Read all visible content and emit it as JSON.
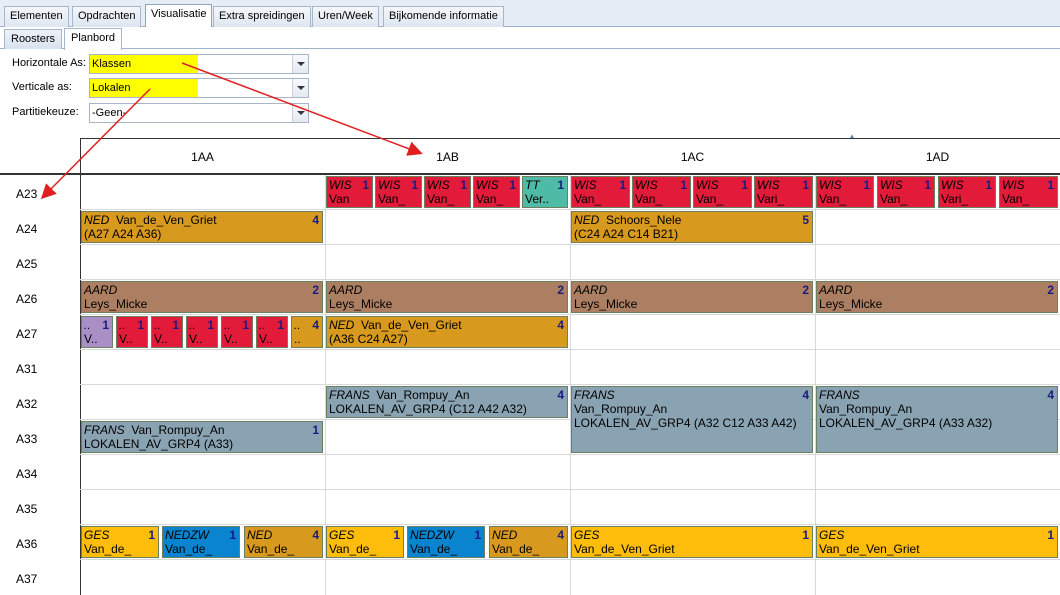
{
  "tabs": [
    "Elementen",
    "Opdrachten",
    "Visualisatie",
    "Extra spreidingen",
    "Uren/Week",
    "Bijkomende informatie"
  ],
  "subtabs": [
    "Roosters",
    "Planbord"
  ],
  "form": {
    "horizontal_label": "Horizontale As:",
    "horizontal_value": "Klassen",
    "vertical_label": "Verticale as:",
    "vertical_value": "Lokalen",
    "partition_label": "Partitiekeuze:",
    "partition_value": "-Geen-"
  },
  "columns": [
    "1AA",
    "1AB",
    "1AC",
    "1AD"
  ],
  "rows": [
    "A23",
    "A24",
    "A25",
    "A26",
    "A27",
    "A31",
    "A32",
    "A33",
    "A34",
    "A35",
    "A36",
    "A37"
  ],
  "colors": {
    "WIS": "#e31b3b",
    "TT": "#4dbba5",
    "NED": "#d89a1e",
    "AARD": "#ad7f62",
    "FRANS": "#8aa3b3",
    "GES": "#fdbd0a",
    "NEDZW": "#0a84cf",
    "other": "#a98fc6",
    "highlight": "#ffff00",
    "arrow": "#e02020"
  },
  "blocks": [
    {
      "id": "b1",
      "subj": "WIS",
      "count": "1",
      "teacher": "Van",
      "cls": "c-red"
    },
    {
      "id": "b2",
      "subj": "WIS",
      "count": "1",
      "teacher": "Van_",
      "cls": "c-red"
    },
    {
      "id": "b3",
      "subj": "WIS",
      "count": "1",
      "teacher": "Van_",
      "cls": "c-red"
    },
    {
      "id": "b4",
      "subj": "WIS",
      "count": "1",
      "teacher": "Van_",
      "cls": "c-red"
    },
    {
      "id": "b5",
      "subj": "TT",
      "count": "1",
      "teacher": "Ver..",
      "cls": "c-teal"
    },
    {
      "id": "b6",
      "subj": "WIS",
      "count": "1",
      "teacher": "Van_",
      "cls": "c-red"
    },
    {
      "id": "b7",
      "subj": "WIS",
      "count": "1",
      "teacher": "Van_",
      "cls": "c-red"
    },
    {
      "id": "b8",
      "subj": "WIS",
      "count": "1",
      "teacher": "Van_",
      "cls": "c-red"
    },
    {
      "id": "b9",
      "subj": "WIS",
      "count": "1",
      "teacher": "Vari_",
      "cls": "c-red"
    },
    {
      "id": "b10",
      "subj": "WIS",
      "count": "1",
      "teacher": "Van_",
      "cls": "c-red"
    },
    {
      "id": "b11",
      "subj": "WIS",
      "count": "1",
      "teacher": "Van_",
      "cls": "c-red"
    },
    {
      "id": "b12",
      "subj": "WIS",
      "count": "1",
      "teacher": "Vari_",
      "cls": "c-red"
    },
    {
      "id": "b13",
      "subj": "WIS",
      "count": "1",
      "teacher": "Van_",
      "cls": "c-red"
    },
    {
      "id": "b14",
      "subj": "NED",
      "count": "4",
      "teacher": "Van_de_Ven_Griet",
      "rooms": "(A27 A24 A36)",
      "cls": "c-orange"
    },
    {
      "id": "b15",
      "subj": "NED",
      "count": "5",
      "teacher": "Schoors_Nele",
      "rooms": "(C24 A24 C14 B21)",
      "cls": "c-orange"
    },
    {
      "id": "b16",
      "subj": "AARD",
      "count": "2",
      "teacher": "Leys_Micke",
      "cls": "c-brown"
    },
    {
      "id": "b17",
      "subj": "AARD",
      "count": "2",
      "teacher": "Leys_Micke",
      "cls": "c-brown"
    },
    {
      "id": "b18",
      "subj": "AARD",
      "count": "2",
      "teacher": "Leys_Micke",
      "cls": "c-brown"
    },
    {
      "id": "b19",
      "subj": "AARD",
      "count": "2",
      "teacher": "Leys_Micke",
      "cls": "c-brown"
    },
    {
      "id": "b20",
      "subj": "..",
      "count": "1",
      "teacher": "V..",
      "cls": "c-purple"
    },
    {
      "id": "b21",
      "subj": "..",
      "count": "1",
      "teacher": "V..",
      "cls": "c-red"
    },
    {
      "id": "b22",
      "subj": "..",
      "count": "1",
      "teacher": "V..",
      "cls": "c-red"
    },
    {
      "id": "b23",
      "subj": "..",
      "count": "1",
      "teacher": "V..",
      "cls": "c-red"
    },
    {
      "id": "b24",
      "subj": "..",
      "count": "1",
      "teacher": "V..",
      "cls": "c-red"
    },
    {
      "id": "b25",
      "subj": "..",
      "count": "1",
      "teacher": "V..",
      "cls": "c-red"
    },
    {
      "id": "b26",
      "subj": "..",
      "count": "4",
      "teacher": "..",
      "cls": "c-orange"
    },
    {
      "id": "b27",
      "subj": "NED",
      "count": "4",
      "teacher": "Van_de_Ven_Griet",
      "rooms": "(A36 C24 A27)",
      "cls": "c-orange"
    },
    {
      "id": "b28",
      "subj": "FRANS",
      "count": "4",
      "teacher": "Van_Rompuy_An",
      "rooms": "LOKALEN_AV_GRP4 (C12 A42 A32)",
      "cls": "c-grey"
    },
    {
      "id": "b29",
      "subj": "FRANS",
      "count": "4",
      "teacher": "Van_Rompuy_An",
      "rooms": "LOKALEN_AV_GRP4 (A32 C12 A33 A42)",
      "cls": "c-grey"
    },
    {
      "id": "b30",
      "subj": "FRANS",
      "count": "4",
      "teacher": "Van_Rompuy_An",
      "rooms": "LOKALEN_AV_GRP4 (A33 A32)",
      "cls": "c-grey"
    },
    {
      "id": "b31",
      "subj": "FRANS",
      "count": "1",
      "teacher": "Van_Rompuy_An",
      "rooms": "LOKALEN_AV_GRP4 (A33)",
      "cls": "c-grey"
    },
    {
      "id": "b32",
      "subj": "GES",
      "count": "1",
      "teacher": "Van_de_",
      "cls": "c-yellow"
    },
    {
      "id": "b33",
      "subj": "NEDZW",
      "count": "1",
      "teacher": "Van_de_",
      "cls": "c-blue"
    },
    {
      "id": "b34",
      "subj": "NED",
      "count": "4",
      "teacher": "Van_de_",
      "cls": "c-orange"
    },
    {
      "id": "b35",
      "subj": "GES",
      "count": "1",
      "teacher": "Van_de_",
      "cls": "c-yellow"
    },
    {
      "id": "b36",
      "subj": "NEDZW",
      "count": "1",
      "teacher": "Van_de_",
      "cls": "c-blue"
    },
    {
      "id": "b37",
      "subj": "NED",
      "count": "4",
      "teacher": "Van_de_",
      "cls": "c-orange"
    },
    {
      "id": "b38",
      "subj": "GES",
      "count": "1",
      "teacher": "Van_de_Ven_Griet",
      "cls": "c-yellow"
    },
    {
      "id": "b39",
      "subj": "GES",
      "count": "1",
      "teacher": "Van_de_Ven_Griet",
      "cls": "c-yellow"
    }
  ]
}
